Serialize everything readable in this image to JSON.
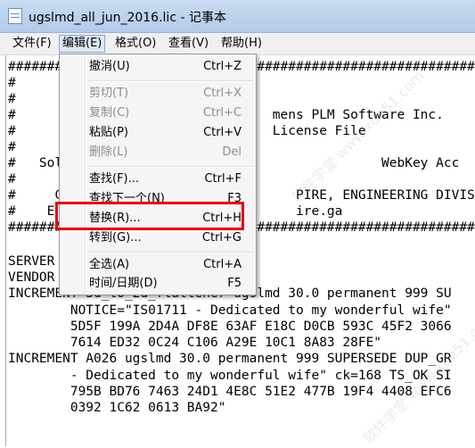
{
  "window": {
    "title": "ugslmd_all_jun_2016.lic - 记事本"
  },
  "menubar": {
    "items": [
      "文件(F)",
      "编辑(E)",
      "格式(O)",
      "查看(V)",
      "帮助(H)"
    ]
  },
  "editor": {
    "lines": [
      "########################################################################",
      "#",
      "#",
      "#                                 mens PLM Software Inc.",
      "#                                 License File",
      "#",
      "#   Sol                                         WebKey Acc",
      "#",
      "#     C                              PIRE, ENGINEERING DIVISION",
      "#    E                               ire.ga",
      "########################################################################",
      "",
      "SERVER",
      "VENDOR",
      "INCREMENT 3d_to_2d_flattener ugslmd 30.0 permanent 999 SU",
      "        NOTICE=\"IS01711 - Dedicated to my wonderful wife\"",
      "        5D5F 199A 2D4A DF8E 63AF E18C D0CB 593C 45F2 3066",
      "        7614 ED32 0C24 C106 A29E 10C1 8A83 28FE\"",
      "INCREMENT A026 ugslmd 30.0 permanent 999 SUPERSEDE DUP_GR",
      "        - Dedicated to my wonderful wife\" ck=168 TS_OK SI",
      "        795B BD76 7463 24D1 4E8C 51E2 477B 19F4 4408 EFC6",
      "        0392 1C62 0613 BA92\""
    ]
  },
  "edit_menu": {
    "items": [
      {
        "label": "撤消(U)",
        "shortcut": "Ctrl+Z",
        "enabled": true
      },
      {
        "label": "剪切(T)",
        "shortcut": "Ctrl+X",
        "enabled": false
      },
      {
        "label": "复制(C)",
        "shortcut": "Ctrl+C",
        "enabled": false
      },
      {
        "label": "粘贴(P)",
        "shortcut": "Ctrl+V",
        "enabled": true
      },
      {
        "label": "删除(L)",
        "shortcut": "Del",
        "enabled": false
      },
      {
        "label": "查找(F)...",
        "shortcut": "Ctrl+F",
        "enabled": true
      },
      {
        "label": "查找下一个(N)",
        "shortcut": "F3",
        "enabled": true
      },
      {
        "label": "替换(R)...",
        "shortcut": "Ctrl+H",
        "enabled": true
      },
      {
        "label": "转到(G)...",
        "shortcut": "Ctrl+G",
        "enabled": true
      },
      {
        "label": "全选(A)",
        "shortcut": "Ctrl+A",
        "enabled": true
      },
      {
        "label": "时间/日期(D)",
        "shortcut": "F5",
        "enabled": true
      }
    ],
    "highlighted_item": "替换(R)..."
  },
  "watermark": {
    "text": "软件学堂 www.xue51.com"
  },
  "colors": {
    "highlight_border": "#e60012",
    "disabled_text": "#8d8d8d"
  }
}
